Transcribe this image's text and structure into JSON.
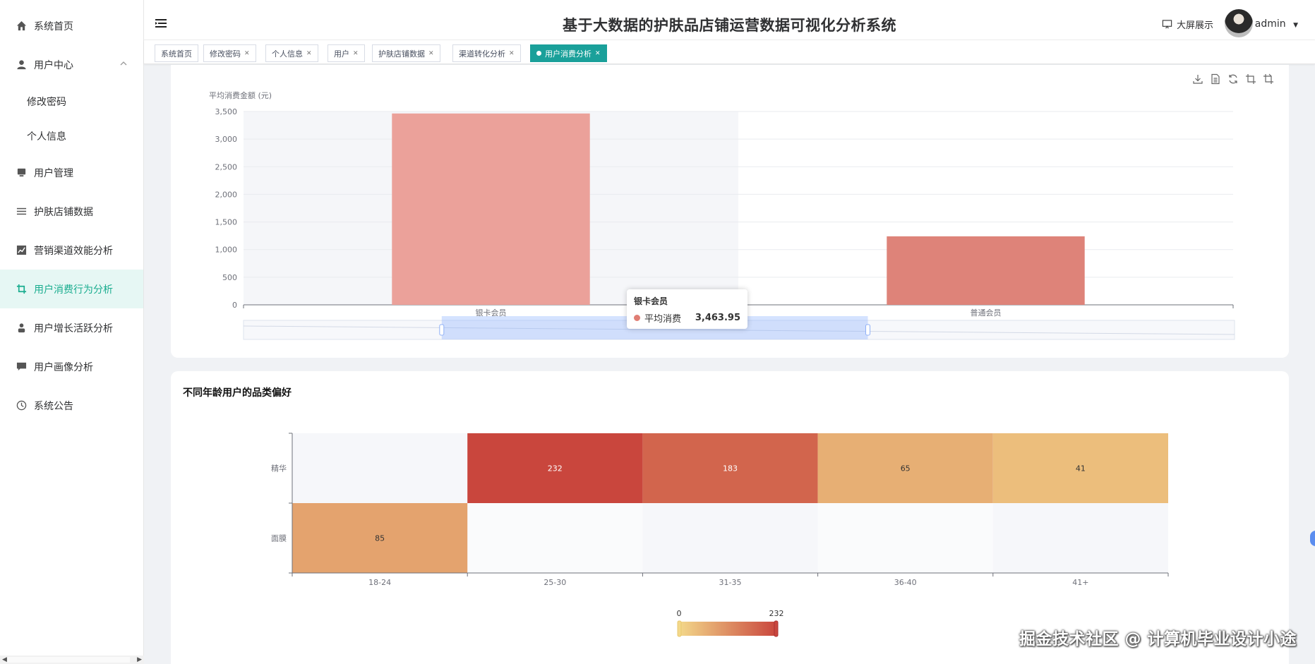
{
  "sidebar": {
    "items": [
      {
        "label": "系统首页",
        "icon": "home-icon"
      },
      {
        "label": "用户中心",
        "icon": "user-icon",
        "expanded": true,
        "children": [
          "修改密码",
          "个人信息"
        ]
      },
      {
        "label": "用户管理",
        "icon": "monitor-icon"
      },
      {
        "label": "护肤店铺数据",
        "icon": "list-icon"
      },
      {
        "label": "营销渠道效能分析",
        "icon": "chart-icon"
      },
      {
        "label": "用户消费行为分析",
        "icon": "crop-icon",
        "active": true
      },
      {
        "label": "用户增长活跃分析",
        "icon": "person-icon"
      },
      {
        "label": "用户画像分析",
        "icon": "message-icon"
      },
      {
        "label": "系统公告",
        "icon": "clock-icon"
      }
    ]
  },
  "header": {
    "title": "基于大数据的护肤品店铺运营数据可视化分析系统",
    "screen_button": "大屏展示",
    "user": "admin"
  },
  "tabs": [
    {
      "label": "系统首页",
      "closable": false
    },
    {
      "label": "修改密码",
      "closable": true
    },
    {
      "label": "个人信息",
      "closable": true
    },
    {
      "label": "用户",
      "closable": true
    },
    {
      "label": "护肤店铺数据",
      "closable": true
    },
    {
      "label": "渠道转化分析",
      "closable": true
    },
    {
      "label": "用户消费分析",
      "closable": true,
      "active": true
    }
  ],
  "charts": {
    "bar": {
      "chart_data": {
        "type": "bar",
        "categories": [
          "银卡会员",
          "普通会员"
        ],
        "series": [
          {
            "name": "平均消费",
            "values": [
              3463.95,
              1240
            ]
          }
        ],
        "ylabel": "平均消费金额 (元)",
        "ylim": [
          0,
          3500
        ],
        "yticks": [
          "0",
          "500",
          "1,000",
          "1,500",
          "2,000",
          "2,500",
          "3,000",
          "3,500"
        ],
        "colors": [
          "#eba19a",
          "#de8379"
        ],
        "grid": true,
        "datazoom_range_percent": [
          20,
          63
        ]
      },
      "tooltip": {
        "category": "银卡会员",
        "series": "平均消费",
        "value": "3,463.95"
      }
    },
    "heatmap": {
      "title": "不同年龄用户的品类偏好",
      "chart_data": {
        "type": "heatmap",
        "x_categories": [
          "18-24",
          "25-30",
          "31-35",
          "36-40",
          "41+"
        ],
        "y_categories": [
          "精华",
          "面膜"
        ],
        "cells": [
          {
            "x": "25-30",
            "y": "精华",
            "value": 232
          },
          {
            "x": "31-35",
            "y": "精华",
            "value": 183
          },
          {
            "x": "36-40",
            "y": "精华",
            "value": 65
          },
          {
            "x": "41+",
            "y": "精华",
            "value": 41
          },
          {
            "x": "18-24",
            "y": "面膜",
            "value": 85
          }
        ],
        "visual_map": {
          "min_label": "0",
          "max_label": "232",
          "min": 0,
          "max": 232,
          "colors": [
            "#f3d88a",
            "#c9463d"
          ]
        }
      }
    }
  },
  "watermark": "掘金技术社区 @ 计算机毕业设计小途"
}
